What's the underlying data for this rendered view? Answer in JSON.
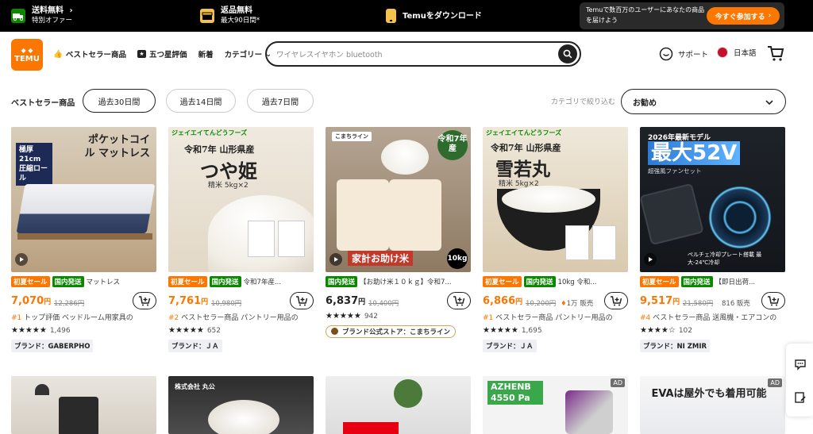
{
  "promo": {
    "shipping": {
      "title": "送料無料",
      "sub": "特別オファー"
    },
    "returns": {
      "title": "返品無料",
      "sub": "最大90日間*"
    },
    "download": {
      "title": "Temuをダウンロード"
    },
    "join": {
      "text": "Temuで数百万のユーザーにあなたの商品を届けよう",
      "cta": "今すぐ参加する"
    }
  },
  "header": {
    "logo": "TEMU",
    "nav": [
      "ベストセラー商品",
      "五つ星評価",
      "新着",
      "カテゴリー"
    ],
    "search_placeholder": "ワイヤレスイヤホン bluetooth",
    "support": "サポート",
    "language": "日本語"
  },
  "filters": {
    "label": "ベストセラー商品",
    "ranges": [
      "過去30日間",
      "過去14日間",
      "過去7日間"
    ],
    "category_label": "カテゴリで絞り込む",
    "sort_value": "お勧め"
  },
  "products": [
    {
      "image_caption": "ポケットコイル マットレス",
      "image_badge": "極厚21cm 圧縮ロール",
      "tags": [
        "初夏セール",
        "国内発送"
      ],
      "title": "マットレス",
      "price_main": "7,070",
      "price_unit": "円",
      "original_price": "12,286円",
      "sold": "",
      "rank_no": "#1",
      "rank_text": "トップ評価 ベッドルーム用家具の",
      "rating_count": "1,496",
      "brand": "ブランド：GABERPHO"
    },
    {
      "image_caption": "つや姫",
      "image_badge": "令和7年 山形県産",
      "image_sub": "精米 5kg×2",
      "image_brand": "ジェイエイてんどうフーズ",
      "tags": [
        "初夏セール",
        "国内発送"
      ],
      "title": "令和7年産...",
      "price_main": "7,761",
      "price_unit": "円",
      "original_price": "10,980円",
      "sold": "",
      "rank_no": "#2",
      "rank_text": "ベストセラー商品 パントリー用品の",
      "rating_count": "652",
      "brand": "ブランド：ＪＡ"
    },
    {
      "image_caption": "家計お助け米",
      "image_badge": "令和7年産",
      "image_weight": "10kg",
      "image_brand": "こまちライン",
      "tags": [
        "国内発送"
      ],
      "title": "【お助け米１０ｋｇ】令和7...",
      "price_main": "6,837",
      "price_unit": "円",
      "original_price": "10,400円",
      "sold": "",
      "rank_no": "",
      "rank_text": "",
      "rating_count": "942",
      "brand": "ブランド公式ストア：こまちライン"
    },
    {
      "image_caption": "雪若丸",
      "image_badge": "令和7年 山形県産",
      "image_sub": "精米 5kg×2",
      "image_brand": "ジェイエイてんどうフーズ",
      "tags": [
        "初夏セール",
        "国内発送"
      ],
      "title": "10kg 令和...",
      "price_main": "6,866",
      "price_unit": "円",
      "original_price": "10,200円",
      "sold": "1万 販売",
      "rank_no": "#1",
      "rank_text": "ベストセラー商品 パントリー用品の",
      "rating_count": "1,695",
      "brand": "ブランド：ＪＡ"
    },
    {
      "image_caption": "最大52V",
      "image_badge": "2026年最新モデル",
      "image_sub": "超強風ファンセット",
      "image_note": "ペルチェ冷却プレート搭載 最大-24℃冷却",
      "tags": [
        "初夏セール",
        "国内発送"
      ],
      "title": "【即日出荷...",
      "price_main": "9,517",
      "price_unit": "円",
      "original_price": "21,580円",
      "sold": "816 販売",
      "rank_no": "#4",
      "rank_text": "ベストセラー商品 送風機・エアコンの",
      "rating_count": "102",
      "brand": "ブランド：NI ZMIR"
    }
  ],
  "row2": [
    {
      "label": ""
    },
    {
      "label": "株式会社 丸公"
    },
    {
      "label": ""
    },
    {
      "label": "AZHENB 4550 Pa",
      "ad": "AD"
    },
    {
      "label": "EVAは屋外でも着用可能",
      "ad": "AD"
    }
  ],
  "colors": {
    "accent": "#fb7701",
    "domestic": "#0a8800",
    "rank": "#fb7701"
  }
}
